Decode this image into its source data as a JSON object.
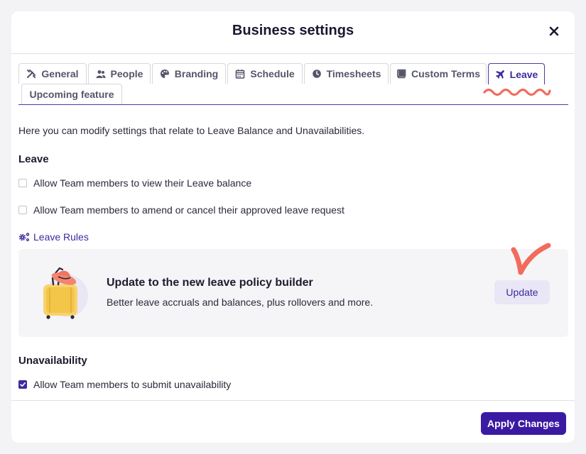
{
  "dialog": {
    "title": "Business settings"
  },
  "tabs": [
    {
      "label": "General",
      "icon": "tools-icon"
    },
    {
      "label": "People",
      "icon": "people-icon"
    },
    {
      "label": "Branding",
      "icon": "palette-icon"
    },
    {
      "label": "Schedule",
      "icon": "calendar-icon"
    },
    {
      "label": "Timesheets",
      "icon": "clock-icon"
    },
    {
      "label": "Custom Terms",
      "icon": "book-icon"
    },
    {
      "label": "Leave",
      "icon": "plane-icon",
      "active": true
    },
    {
      "label": "Upcoming feature"
    }
  ],
  "intro": "Here you can modify settings that relate to Leave Balance and Unavailabilities.",
  "leave": {
    "heading": "Leave",
    "options": [
      {
        "label": "Allow Team members to view their Leave balance",
        "checked": false
      },
      {
        "label": "Allow Team members to amend or cancel their approved leave request",
        "checked": false
      }
    ],
    "rules_link": "Leave Rules"
  },
  "promo": {
    "title": "Update to the new leave policy builder",
    "subtitle": "Better leave accruals and balances, plus rollovers and more.",
    "button": "Update"
  },
  "unavailability": {
    "heading": "Unavailability",
    "options": [
      {
        "label": "Allow Team members to submit unavailability",
        "checked": true
      }
    ]
  },
  "footer": {
    "apply": "Apply Changes"
  },
  "colors": {
    "accent": "#3f2a9e",
    "primary_button": "#3a1aa3",
    "annotation": "#f26b5b"
  }
}
